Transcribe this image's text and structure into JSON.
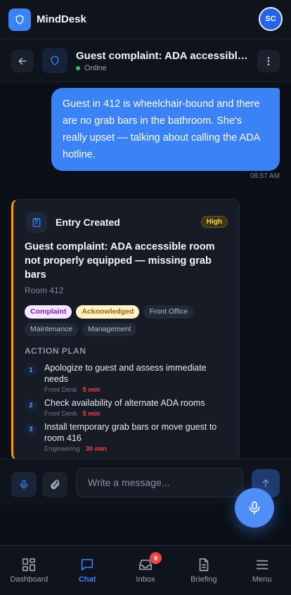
{
  "app": {
    "title": "MindDesk",
    "user_initials": "SC"
  },
  "chat_header": {
    "title": "Guest complaint: ADA accessible ...",
    "status": "Online"
  },
  "messages": [
    {
      "text": "Guest in 412 is wheelchair-bound and there are no grab bars in the bathroom. She's really upset — talking about calling the ADA hotline.",
      "time": "08:57 AM"
    }
  ],
  "entry": {
    "label": "Entry Created",
    "priority": "High",
    "title": "Guest complaint: ADA accessible room not properly equipped — missing grab bars",
    "room": "Room 412",
    "tags": [
      "Complaint",
      "Acknowledged",
      "Front Office",
      "Maintenance",
      "Management"
    ],
    "action_plan_title": "ACTION PLAN",
    "steps": [
      {
        "num": "1",
        "text": "Apologize to guest and assess immediate needs",
        "dept": "Front Desk",
        "time": "5 min"
      },
      {
        "num": "2",
        "text": "Check availability of alternate ADA rooms",
        "dept": "Front Desk",
        "time": "5 min"
      },
      {
        "num": "3",
        "text": "Install temporary grab bars or move guest to room 416",
        "dept": "Engineering",
        "time": "30 min"
      }
    ]
  },
  "composer": {
    "placeholder": "Write a message..."
  },
  "nav": {
    "items": [
      {
        "label": "Dashboard",
        "icon": "grid-icon"
      },
      {
        "label": "Chat",
        "icon": "chat-icon",
        "active": true
      },
      {
        "label": "Inbox",
        "icon": "inbox-icon",
        "badge": "9"
      },
      {
        "label": "Briefing",
        "icon": "document-icon"
      },
      {
        "label": "Menu",
        "icon": "menu-icon"
      }
    ]
  },
  "colors": {
    "accent": "#3b82f6",
    "priority_high": "#f59e0b",
    "online": "#22c55e",
    "badge": "#ef4444"
  }
}
